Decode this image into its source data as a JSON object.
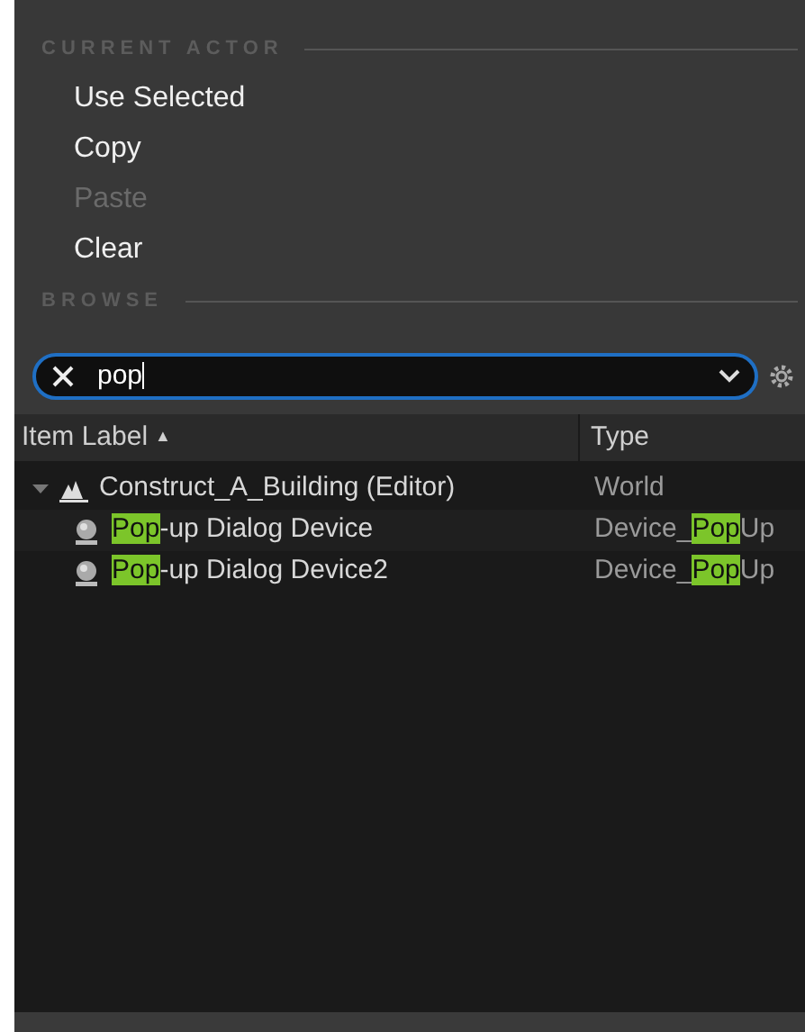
{
  "current_actor": {
    "heading": "CURRENT ACTOR",
    "items": [
      {
        "label": "Use Selected",
        "disabled": false
      },
      {
        "label": "Copy",
        "disabled": false
      },
      {
        "label": "Paste",
        "disabled": true
      },
      {
        "label": "Clear",
        "disabled": false
      }
    ]
  },
  "browse": {
    "heading": "BROWSE"
  },
  "search": {
    "value": "pop"
  },
  "table": {
    "columns": [
      {
        "label": "Item Label",
        "sort": "▲"
      },
      {
        "label": "Type"
      }
    ],
    "rows": [
      {
        "kind": "world",
        "expanded": true,
        "label": [
          {
            "text": "Construct_A_Building (Editor)",
            "highlight": false
          }
        ],
        "type": [
          {
            "text": "World",
            "highlight": false
          }
        ],
        "children": [
          {
            "kind": "device",
            "label": [
              {
                "text": "Pop",
                "highlight": true
              },
              {
                "text": "-up Dialog Device",
                "highlight": false
              }
            ],
            "type": [
              {
                "text": "Device_",
                "highlight": false
              },
              {
                "text": "Pop",
                "highlight": true
              },
              {
                "text": "Up",
                "highlight": false
              }
            ]
          },
          {
            "kind": "device",
            "label": [
              {
                "text": "Pop",
                "highlight": true
              },
              {
                "text": "-up Dialog Device2",
                "highlight": false
              }
            ],
            "type": [
              {
                "text": "Device_",
                "highlight": false
              },
              {
                "text": "Pop",
                "highlight": true
              },
              {
                "text": "Up",
                "highlight": false
              }
            ]
          }
        ]
      }
    ]
  }
}
